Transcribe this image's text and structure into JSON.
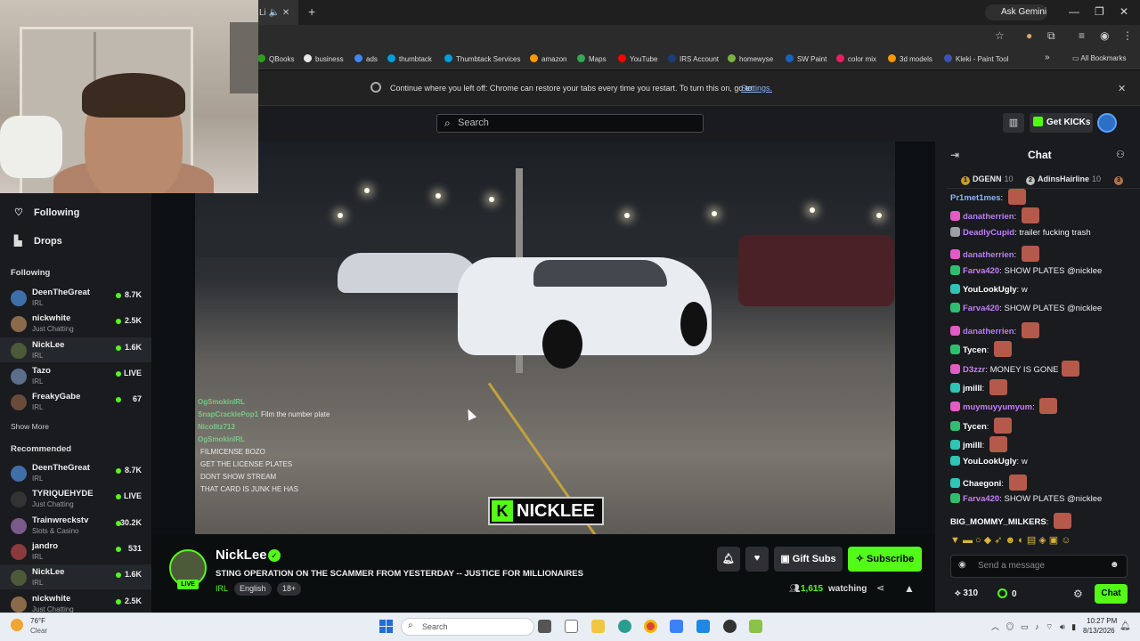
{
  "browser": {
    "tab_title": "Li",
    "gemini_label": "Ask Gemini",
    "bookmarks": [
      {
        "label": "QBooks",
        "color": "#2ca01c"
      },
      {
        "label": "business",
        "color": "#e8e8e8"
      },
      {
        "label": "ads",
        "color": "#4285f4"
      },
      {
        "label": "thumbtack",
        "color": "#009fd9"
      },
      {
        "label": "Thumbtack Services",
        "color": "#009fd9"
      },
      {
        "label": "amazon",
        "color": "#ff9900"
      },
      {
        "label": "Maps",
        "color": "#34a853"
      },
      {
        "label": "YouTube",
        "color": "#ff0000"
      },
      {
        "label": "IRS Account",
        "color": "#1a3d7c"
      },
      {
        "label": "homewyse",
        "color": "#7cb342"
      },
      {
        "label": "SW Paint",
        "color": "#1565c0"
      },
      {
        "label": "color mix",
        "color": "#e91e63"
      },
      {
        "label": "3d models",
        "color": "#ff9800"
      },
      {
        "label": "Kleki - Paint Tool",
        "color": "#3f51b5"
      }
    ],
    "all_bookmarks": "All Bookmarks",
    "restore_text": "Continue where you left off: Chrome can restore your tabs every time you restart. To turn this on, go to",
    "restore_link": "Settings."
  },
  "header": {
    "search_placeholder": "Search",
    "get_kicks": "Get KICKs"
  },
  "sidebar": {
    "nav": [
      {
        "label": "Following",
        "icon": "heart-icon"
      },
      {
        "label": "Drops",
        "icon": "drops-icon"
      }
    ],
    "following_title": "Following",
    "following": [
      {
        "name": "DeenTheGreat",
        "category": "IRL",
        "count": "8.7K",
        "color": "#3f6fa8"
      },
      {
        "name": "nickwhite",
        "category": "Just Chatting",
        "count": "2.5K",
        "color": "#8a6a4a"
      },
      {
        "name": "NickLee",
        "category": "IRL",
        "count": "1.6K",
        "color": "#4d5a3a"
      },
      {
        "name": "Tazo",
        "category": "IRL",
        "count": "LIVE",
        "color": "#5c6f8a"
      },
      {
        "name": "FreakyGabe",
        "category": "IRL",
        "count": "67",
        "color": "#6a4a3a"
      }
    ],
    "show_more": "Show More",
    "recommended_title": "Recommended",
    "recommended": [
      {
        "name": "DeenTheGreat",
        "category": "IRL",
        "count": "8.7K",
        "color": "#3f6fa8"
      },
      {
        "name": "TYRIQUEHYDE",
        "category": "Just Chatting",
        "count": "LIVE",
        "color": "#333333"
      },
      {
        "name": "Trainwreckstv",
        "category": "Slots & Casino",
        "count": "30.2K",
        "color": "#7a5a8a"
      },
      {
        "name": "jandro",
        "category": "IRL",
        "count": "531",
        "color": "#8a3a3a"
      },
      {
        "name": "NickLee",
        "category": "IRL",
        "count": "1.6K",
        "color": "#4d5a3a"
      },
      {
        "name": "nickwhite",
        "category": "Just Chatting",
        "count": "2.5K",
        "color": "#8a6a4a"
      }
    ]
  },
  "video": {
    "overlay_chat": [
      {
        "user": "OgSmokinIRL",
        "text": ""
      },
      {
        "user": "SnapCracklePop1",
        "text": "Film the number plate"
      },
      {
        "user": "NicoIItz713",
        "text": ""
      },
      {
        "user": "OgSmokinIRL",
        "text": ""
      },
      {
        "user": "",
        "text": "FILMICENSE BOZO"
      },
      {
        "user": "",
        "text": "GET THE LICENSE PLATES"
      },
      {
        "user": "",
        "text": "DONT SHOW STREAM"
      },
      {
        "user": "",
        "text": "THAT CARD IS JUNK HE HAS"
      }
    ],
    "logo_text": "NICKLEE",
    "logo_k": "K"
  },
  "stream": {
    "streamer": "NickLee",
    "live": "LIVE",
    "title": "STING OPERATION ON THE SCAMMER FROM YESTERDAY -- JUSTICE FOR MILLIONAIRES",
    "category": "IRL",
    "tags": [
      "English",
      "18+"
    ],
    "gift_subs": "Gift Subs",
    "subscribe": "Subscribe",
    "watching_count": "1,615",
    "watching_label": "watching"
  },
  "chat": {
    "title": "Chat",
    "leaders": [
      {
        "rank": "1",
        "name": "DGENN",
        "score": "10"
      },
      {
        "rank": "2",
        "name": "AdinsHairline",
        "score": "10"
      },
      {
        "rank": "3",
        "name": "",
        "score": ""
      }
    ],
    "messages": [
      {
        "user": "Pr1met1mes",
        "color": "#8ab4f8",
        "text": "",
        "emote": true,
        "badge": ""
      },
      {
        "user": "danatherrien",
        "color": "#b97cf2",
        "text": "",
        "emote": true,
        "badge": "#e45bc6"
      },
      {
        "user": "DeadlyCupid",
        "color": "#c77dff",
        "text": "trailer fucking trash",
        "emote": false,
        "badge": "#9aa0a6"
      },
      {
        "user": "danatherrien",
        "color": "#b97cf2",
        "text": "",
        "emote": true,
        "badge": "#e45bc6"
      },
      {
        "user": "Farva420",
        "color": "#c77dff",
        "text": "SHOW PLATES @nicklee",
        "emote": false,
        "badge": "#2fbf71"
      },
      {
        "user": "YouLookUgly",
        "color": "#ffffff",
        "text": "w",
        "emote": false,
        "badge": "#2ec4b6"
      },
      {
        "user": "Farva420",
        "color": "#c77dff",
        "text": "SHOW PLATES @nicklee",
        "emote": false,
        "badge": "#2fbf71"
      },
      {
        "user": "danatherrien",
        "color": "#b97cf2",
        "text": "",
        "emote": true,
        "badge": "#e45bc6"
      },
      {
        "user": "Tycen",
        "color": "#ffffff",
        "text": "",
        "emote": true,
        "badge": "#2fbf71"
      },
      {
        "user": "D3zzr",
        "color": "#c77dff",
        "text": "MONEY IS GONE",
        "emote": true,
        "badge": "#e45bc6"
      },
      {
        "user": "jmilll",
        "color": "#ffffff",
        "text": "",
        "emote": true,
        "badge": "#2ec4b6"
      },
      {
        "user": "muymuyyumyum",
        "color": "#c77dff",
        "text": "",
        "emote": true,
        "badge": "#e45bc6"
      },
      {
        "user": "Tycen",
        "color": "#ffffff",
        "text": "",
        "emote": true,
        "badge": "#2fbf71"
      },
      {
        "user": "jmilll",
        "color": "#ffffff",
        "text": "",
        "emote": true,
        "badge": "#2ec4b6"
      },
      {
        "user": "YouLookUgly",
        "color": "#ffffff",
        "text": "w",
        "emote": false,
        "badge": "#2ec4b6"
      },
      {
        "user": "Chaegoni",
        "color": "#ffffff",
        "text": "",
        "emote": true,
        "badge": "#2ec4b6"
      },
      {
        "user": "Farva420",
        "color": "#c77dff",
        "text": "SHOW PLATES @nicklee",
        "emote": false,
        "badge": "#2fbf71"
      },
      {
        "user": "BIG_MOMMY_MILKERS",
        "color": "#ffffff",
        "text": "",
        "emote": true,
        "badge": ""
      }
    ],
    "send_placeholder": "Send a message",
    "kicks": "310",
    "points": "0",
    "chat_button": "Chat"
  },
  "taskbar": {
    "temperature": "76°F",
    "condition": "Clear",
    "search": "Search",
    "time": "10:27 PM",
    "date": "8/13/2026"
  },
  "colors": {
    "accent": "#53fc18",
    "bg": "#0b0e0f",
    "panel": "#191b1f"
  }
}
